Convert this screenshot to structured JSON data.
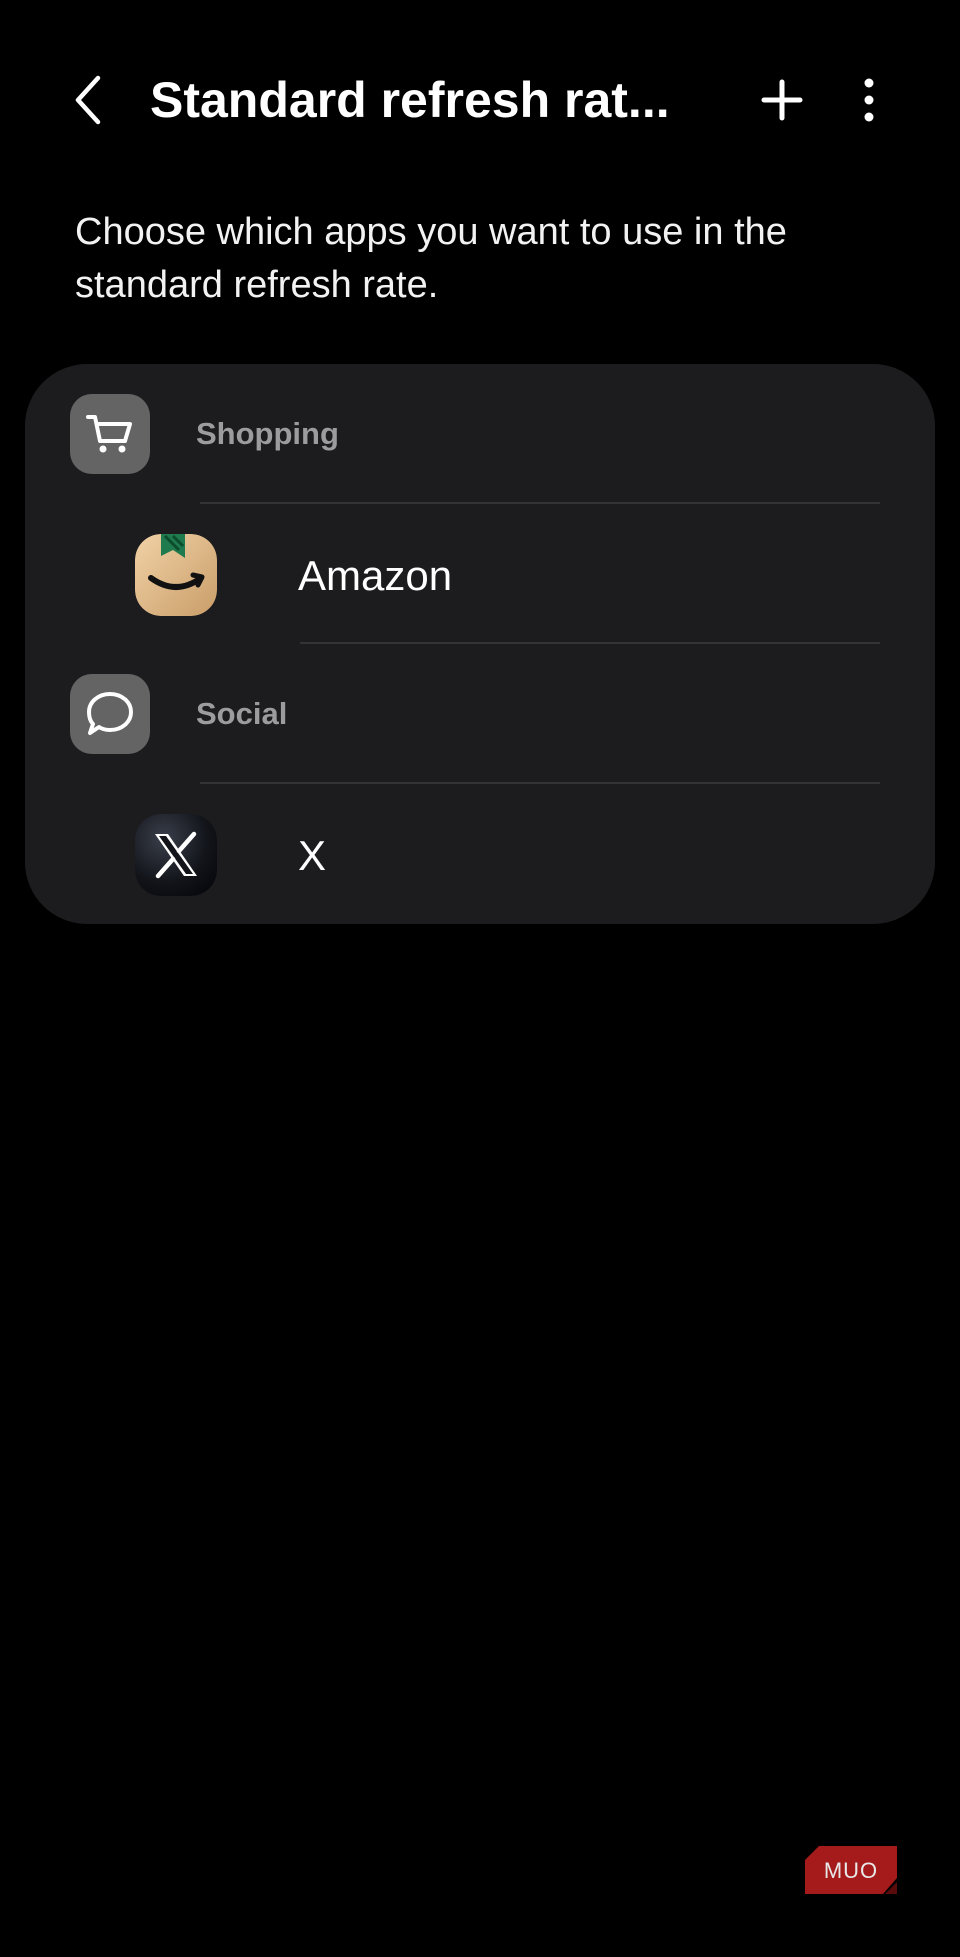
{
  "header": {
    "title": "Standard refresh rat...",
    "back_icon": "chevron-left-icon",
    "add_icon": "plus-icon",
    "more_icon": "vertical-dots-icon"
  },
  "description": "Choose which apps you want to use in the standard refresh rate.",
  "categories": [
    {
      "label": "Shopping",
      "icon": "shopping-cart-icon",
      "apps": [
        {
          "label": "Amazon",
          "icon": "amazon-icon"
        }
      ]
    },
    {
      "label": "Social",
      "icon": "chat-bubble-icon",
      "apps": [
        {
          "label": "X",
          "icon": "x-logo-icon"
        }
      ]
    }
  ],
  "watermark": {
    "text": "MUO"
  },
  "colors": {
    "background": "#000000",
    "card": "#1c1c1e",
    "category_icon_bg": "#646464",
    "category_label": "#9c9c9e",
    "watermark": "#a51b1b"
  }
}
